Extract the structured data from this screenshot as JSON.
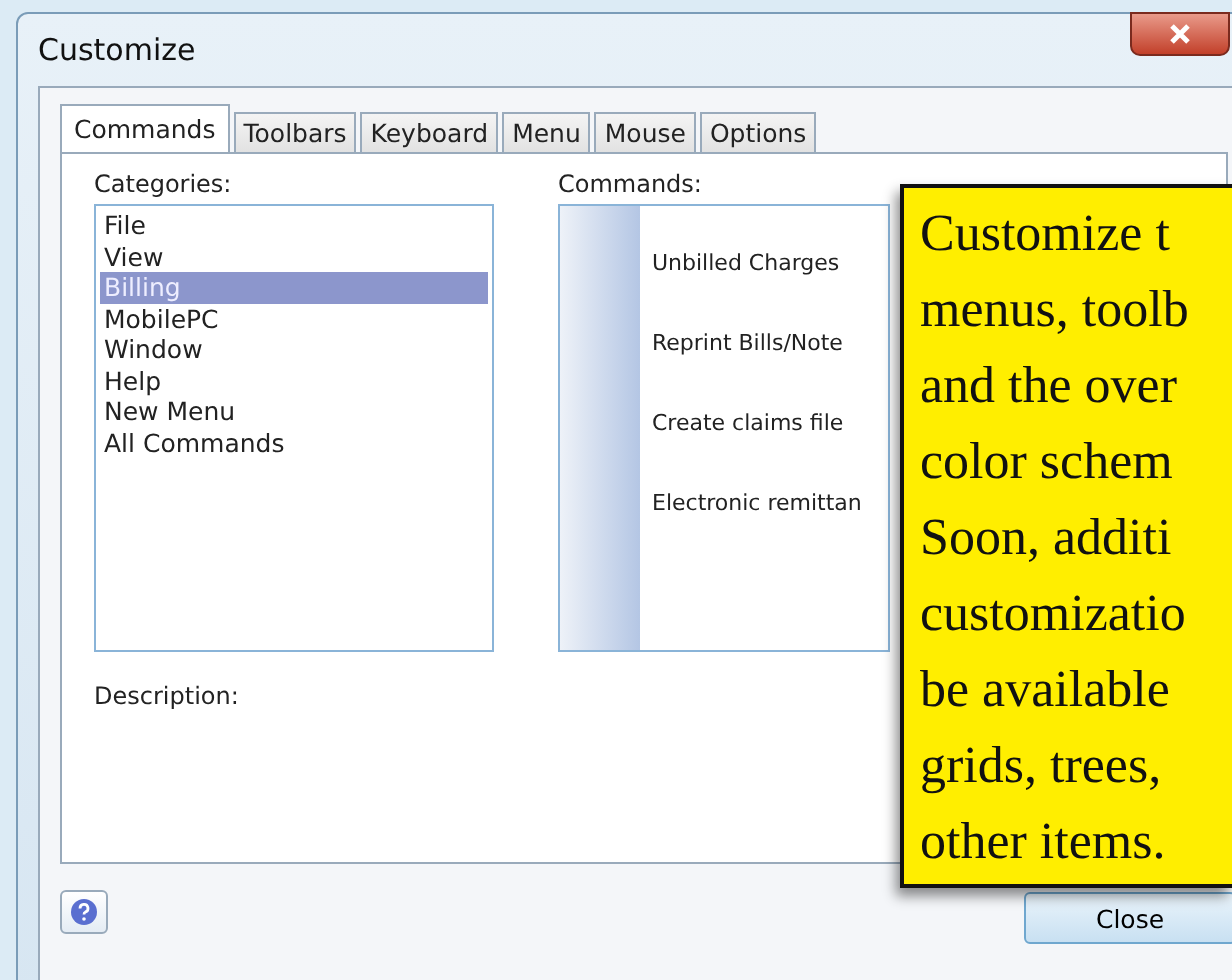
{
  "window": {
    "title": "Customize"
  },
  "tabs": [
    {
      "label": "Commands",
      "selected": true
    },
    {
      "label": "Toolbars",
      "selected": false
    },
    {
      "label": "Keyboard",
      "selected": false
    },
    {
      "label": "Menu",
      "selected": false
    },
    {
      "label": "Mouse",
      "selected": false
    },
    {
      "label": "Options",
      "selected": false
    }
  ],
  "categories": {
    "label": "Categories:",
    "items": [
      {
        "label": "File",
        "selected": false
      },
      {
        "label": "View",
        "selected": false
      },
      {
        "label": "Billing",
        "selected": true
      },
      {
        "label": "MobilePC",
        "selected": false
      },
      {
        "label": "Window",
        "selected": false
      },
      {
        "label": "Help",
        "selected": false
      },
      {
        "label": "New Menu",
        "selected": false
      },
      {
        "label": "All Commands",
        "selected": false
      }
    ]
  },
  "commands": {
    "label": "Commands:",
    "items": [
      "Unbilled Charges",
      "Reprint Bills/Note",
      "Create claims file",
      "Electronic remittan"
    ]
  },
  "description": {
    "label": "Description:"
  },
  "buttons": {
    "close": "Close"
  },
  "callout": {
    "lines": [
      "Customize t",
      "menus, toolb",
      "and the over",
      "color schem",
      "Soon, additi",
      "customizatio",
      "be available",
      "grids, trees,",
      "other items."
    ]
  }
}
